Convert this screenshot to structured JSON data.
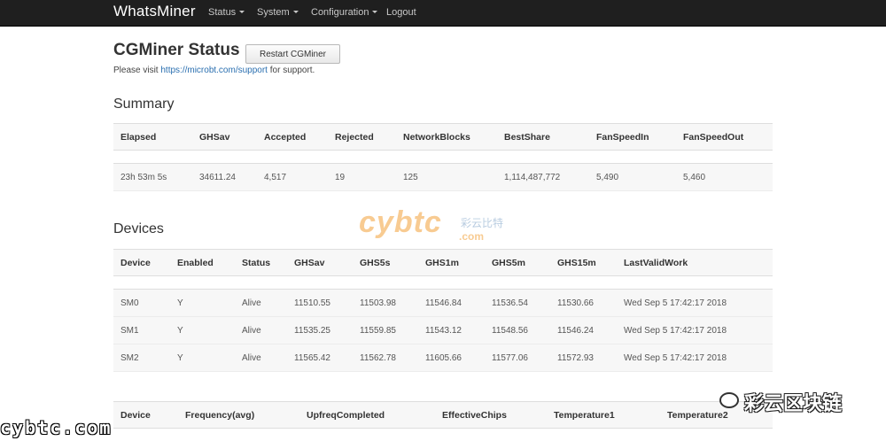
{
  "nav": {
    "brand": "WhatsMiner",
    "items": [
      {
        "label": "Status",
        "dropdown": true
      },
      {
        "label": "System",
        "dropdown": true
      },
      {
        "label": "Configuration",
        "dropdown": true
      },
      {
        "label": "Logout",
        "dropdown": false
      }
    ]
  },
  "header": {
    "title": "CGMiner Status",
    "restart_label": "Restart CGMiner",
    "support_prefix": "Please visit ",
    "support_link": "https://microbt.com/support",
    "support_suffix": " for support."
  },
  "summary": {
    "title": "Summary",
    "columns": [
      "Elapsed",
      "GHSav",
      "Accepted",
      "Rejected",
      "NetworkBlocks",
      "BestShare",
      "FanSpeedIn",
      "FanSpeedOut"
    ],
    "row": [
      "23h 53m 5s",
      "34611.24",
      "4,517",
      "19",
      "125",
      "1,114,487,772",
      "5,490",
      "5,460"
    ]
  },
  "devices": {
    "title": "Devices",
    "columns": [
      "Device",
      "Enabled",
      "Status",
      "GHSav",
      "GHS5s",
      "GHS1m",
      "GHS5m",
      "GHS15m",
      "LastValidWork"
    ],
    "rows": [
      [
        "SM0",
        "Y",
        "Alive",
        "11510.55",
        "11503.98",
        "11546.84",
        "11536.54",
        "11530.66",
        "Wed Sep 5 17:42:17 2018"
      ],
      [
        "SM1",
        "Y",
        "Alive",
        "11535.25",
        "11559.85",
        "11543.12",
        "11548.56",
        "11546.24",
        "Wed Sep 5 17:42:17 2018"
      ],
      [
        "SM2",
        "Y",
        "Alive",
        "11565.42",
        "11562.78",
        "11605.66",
        "11577.06",
        "11572.93",
        "Wed Sep 5 17:42:17 2018"
      ]
    ]
  },
  "device_details": {
    "columns": [
      "Device",
      "Frequency(avg)",
      "UpfreqCompleted",
      "EffectiveChips",
      "Temperature1",
      "Temperature2"
    ]
  },
  "watermarks": {
    "center": "cybtc",
    "center_com": ".com",
    "center_cn": "彩云比特",
    "bottom_left": "cybtc.com",
    "bottom_right": "彩云区块链"
  },
  "colors": {
    "navbar": "#1f1f1f",
    "link": "#2a6fb0",
    "table_bg": "#f7f7f7",
    "watermark": "#f3a23a"
  }
}
